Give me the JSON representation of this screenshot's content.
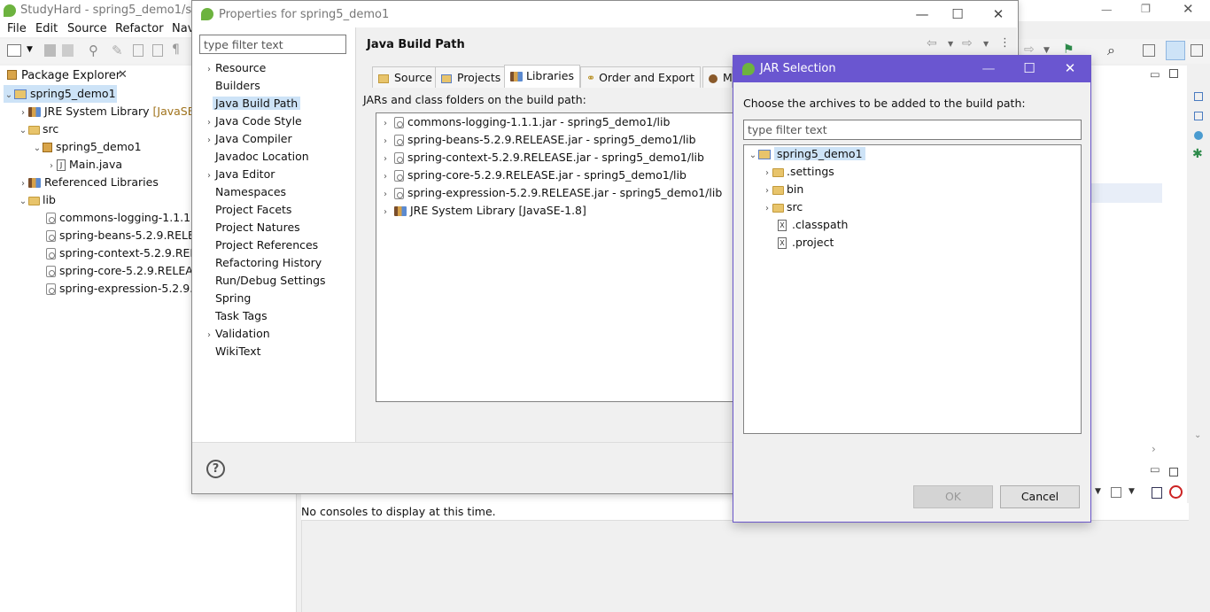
{
  "main_window": {
    "title": "StudyHard - spring5_demo1/src/s",
    "menu": [
      "File",
      "Edit",
      "Source",
      "Refactor",
      "Nav"
    ]
  },
  "package_explorer": {
    "tab_label": "Package Explorer",
    "tree": [
      {
        "label": "spring5_demo1",
        "level": 0,
        "kind": "project",
        "expanded": true
      },
      {
        "label": "JRE System Library",
        "suffix": "[JavaSE-",
        "level": 1,
        "kind": "library"
      },
      {
        "label": "src",
        "level": 1,
        "kind": "folder",
        "expanded": true
      },
      {
        "label": "spring5_demo1",
        "level": 2,
        "kind": "package",
        "expanded": true
      },
      {
        "label": "Main.java",
        "level": 3,
        "kind": "java"
      },
      {
        "label": "Referenced Libraries",
        "level": 1,
        "kind": "library"
      },
      {
        "label": "lib",
        "level": 1,
        "kind": "folder",
        "expanded": true
      },
      {
        "label": "commons-logging-1.1.1.j",
        "level": 2,
        "kind": "jar"
      },
      {
        "label": "spring-beans-5.2.9.RELEA",
        "level": 2,
        "kind": "jar"
      },
      {
        "label": "spring-context-5.2.9.RELE",
        "level": 2,
        "kind": "jar"
      },
      {
        "label": "spring-core-5.2.9.RELEAS",
        "level": 2,
        "kind": "jar"
      },
      {
        "label": "spring-expression-5.2.9.F",
        "level": 2,
        "kind": "jar"
      }
    ]
  },
  "console": {
    "empty_message": "No consoles to display at this time."
  },
  "properties_dialog": {
    "title": "Properties for spring5_demo1",
    "filter_placeholder": "type filter text",
    "nav_items": [
      {
        "label": "Resource",
        "expandable": true
      },
      {
        "label": "Builders",
        "expandable": false
      },
      {
        "label": "Java Build Path",
        "expandable": false,
        "selected": true
      },
      {
        "label": "Java Code Style",
        "expandable": true
      },
      {
        "label": "Java Compiler",
        "expandable": true
      },
      {
        "label": "Javadoc Location",
        "expandable": false
      },
      {
        "label": "Java Editor",
        "expandable": true
      },
      {
        "label": "Namespaces",
        "expandable": false
      },
      {
        "label": "Project Facets",
        "expandable": false
      },
      {
        "label": "Project Natures",
        "expandable": false
      },
      {
        "label": "Project References",
        "expandable": false
      },
      {
        "label": "Refactoring History",
        "expandable": false
      },
      {
        "label": "Run/Debug Settings",
        "expandable": false
      },
      {
        "label": "Spring",
        "expandable": false
      },
      {
        "label": "Task Tags",
        "expandable": false
      },
      {
        "label": "Validation",
        "expandable": true
      },
      {
        "label": "WikiText",
        "expandable": false
      }
    ],
    "page_title": "Java Build Path",
    "tabs": [
      "Source",
      "Projects",
      "Libraries",
      "Order and Export",
      "M"
    ],
    "active_tab": "Libraries",
    "libraries_caption": "JARs and class folders on the build path:",
    "libraries": [
      "commons-logging-1.1.1.jar - spring5_demo1/lib",
      "spring-beans-5.2.9.RELEASE.jar - spring5_demo1/lib",
      "spring-context-5.2.9.RELEASE.jar - spring5_demo1/lib",
      "spring-core-5.2.9.RELEASE.jar - spring5_demo1/lib",
      "spring-expression-5.2.9.RELEASE.jar - spring5_demo1/lib",
      "JRE System Library [JavaSE-1.8]"
    ],
    "help_glyph": "?"
  },
  "jar_dialog": {
    "title": "JAR Selection",
    "caption": "Choose the archives to be added to the build path:",
    "filter_placeholder": "type filter text",
    "tree": [
      {
        "label": "spring5_demo1",
        "level": 0,
        "kind": "project",
        "expanded": true,
        "selected": true
      },
      {
        "label": ".settings",
        "level": 1,
        "kind": "folder",
        "expandable": true
      },
      {
        "label": "bin",
        "level": 1,
        "kind": "folder",
        "expandable": true
      },
      {
        "label": "src",
        "level": 1,
        "kind": "folder",
        "expandable": true
      },
      {
        "label": ".classpath",
        "level": 1,
        "kind": "file",
        "expandable": false
      },
      {
        "label": ".project",
        "level": 1,
        "kind": "file",
        "expandable": false
      }
    ],
    "ok_label": "OK",
    "cancel_label": "Cancel",
    "accent_color": "#6a56d0"
  }
}
